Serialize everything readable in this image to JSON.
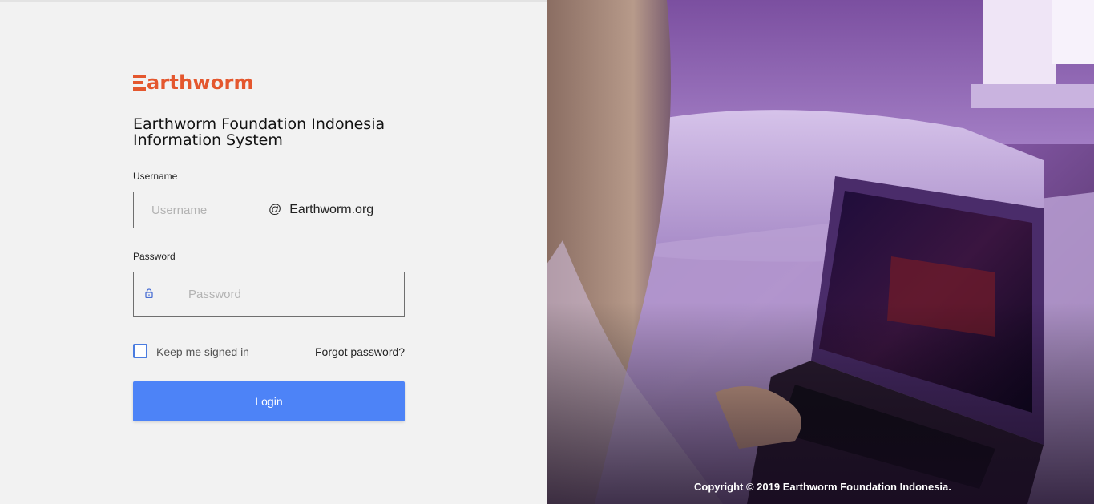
{
  "brand": {
    "logo_text": "arthworm",
    "logo_alt": "Earthworm",
    "color": "#e4572e"
  },
  "page": {
    "title_line1": "Earthworm Foundation Indonesia",
    "title_line2": "Information System"
  },
  "form": {
    "username_label": "Username",
    "username_placeholder": "Username",
    "username_value": "",
    "domain_at": "@",
    "domain_text": "Earthworm.org",
    "password_label": "Password",
    "password_placeholder": "Password",
    "password_value": "",
    "keep_signed_in_label": "Keep me signed in",
    "keep_signed_in_checked": false,
    "forgot_password": "Forgot password?",
    "login_button": "Login",
    "accent_color": "#4d83f7"
  },
  "footer": {
    "copyright": "Copyright © 2019 Earthworm Foundation Indonesia."
  },
  "icons": {
    "lock": "lock-icon",
    "hero": "hero-photo"
  }
}
